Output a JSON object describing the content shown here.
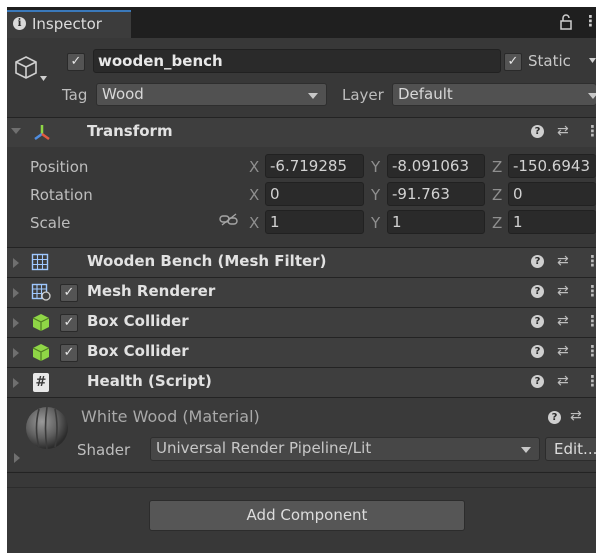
{
  "tab": {
    "label": "Inspector",
    "lock_icon": "lock-icon",
    "more_icon": "kebab-menu-icon"
  },
  "header": {
    "object_icon": "cube-outline-icon",
    "active_checked": true,
    "name": "wooden_bench",
    "static_checked": true,
    "static_label": "Static",
    "tag_label": "Tag",
    "tag_value": "Wood",
    "layer_label": "Layer",
    "layer_value": "Default"
  },
  "transform": {
    "title": "Transform",
    "icon": "transform-axes-icon",
    "position": {
      "label": "Position",
      "x": "-6.719285",
      "y": "-8.091063",
      "z": "-150.6943"
    },
    "rotation": {
      "label": "Rotation",
      "x": "0",
      "y": "-91.763",
      "z": "0"
    },
    "scale": {
      "label": "Scale",
      "x": "1",
      "y": "1",
      "z": "1",
      "link_icon": "unlinked-chain-icon"
    },
    "axis_labels": {
      "x": "X",
      "y": "Y",
      "z": "Z"
    }
  },
  "components": [
    {
      "title": "Wooden Bench (Mesh Filter)",
      "icon": "mesh-grid-icon",
      "has_checkbox": false
    },
    {
      "title": "Mesh Renderer",
      "icon": "mesh-renderer-icon",
      "has_checkbox": true,
      "checked": true
    },
    {
      "title": "Box Collider",
      "icon": "box-collider-icon",
      "has_checkbox": true,
      "checked": true
    },
    {
      "title": "Box Collider",
      "icon": "box-collider-icon",
      "has_checkbox": true,
      "checked": true
    },
    {
      "title": "Health (Script)",
      "icon": "script-hash-icon",
      "has_checkbox": false
    }
  ],
  "material": {
    "title": "White Wood (Material)",
    "thumbnail": "material-sphere-thumbnail",
    "shader_label": "Shader",
    "shader_value": "Universal Render Pipeline/Lit",
    "edit_label": "Edit..."
  },
  "add_component_label": "Add Component",
  "colors": {
    "panel": "#383838",
    "tabbar": "#1f1f1f",
    "accent": "#3a79bb",
    "field": "#2a2a2a",
    "collider_green": "#8fd646"
  }
}
